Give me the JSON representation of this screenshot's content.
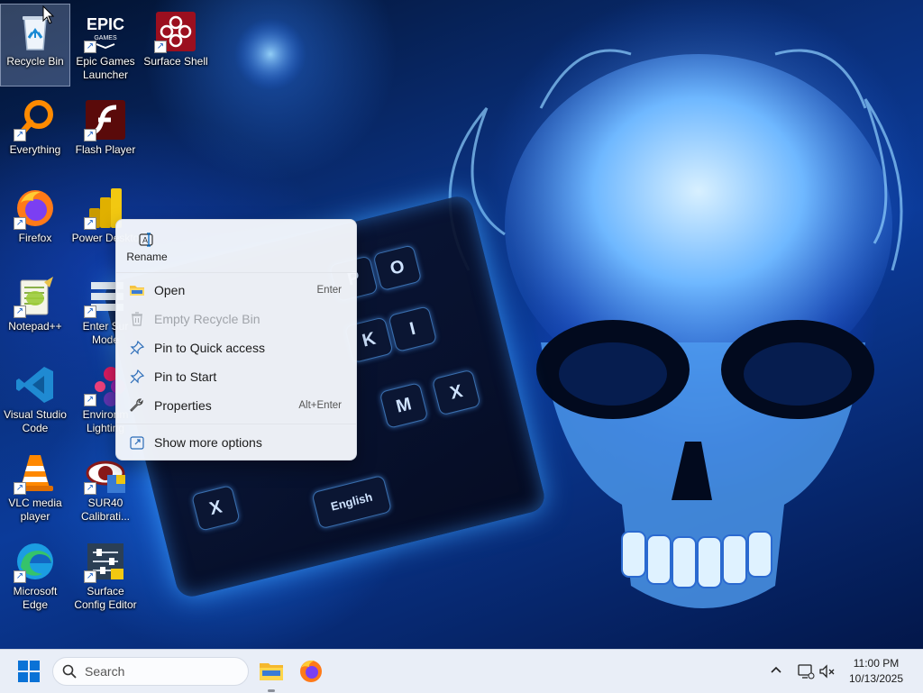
{
  "desktop": {
    "icons": [
      {
        "label": "Recycle Bin",
        "icon": "recycle-bin-icon"
      },
      {
        "label": "Epic Games Launcher",
        "icon": "epic-games-icon"
      },
      {
        "label": "Surface Shell",
        "icon": "surface-shell-icon"
      },
      {
        "label": "Everything",
        "icon": "everything-search-icon"
      },
      {
        "label": "Flash Player",
        "icon": "flash-player-icon"
      },
      {
        "label": "Firefox",
        "icon": "firefox-icon"
      },
      {
        "label": "Power Deskto",
        "icon": "power-bi-icon"
      },
      {
        "label": "Notepad++",
        "icon": "notepad-plus-plus-icon"
      },
      {
        "label": "Enter Sur Mode",
        "icon": "surface-mode-icon"
      },
      {
        "label": "Visual Studio Code",
        "icon": "vscode-icon"
      },
      {
        "label": "Environm Lighting",
        "icon": "environment-lighting-icon"
      },
      {
        "label": "VLC media player",
        "icon": "vlc-icon"
      },
      {
        "label": "SUR40 Calibrati...",
        "icon": "sur40-calibration-icon"
      },
      {
        "label": "Microsoft Edge",
        "icon": "edge-icon"
      },
      {
        "label": "Surface Config Editor",
        "icon": "surface-config-editor-icon"
      }
    ],
    "epic_logo_text": "EPIC",
    "epic_logo_sub": "GAMES",
    "wallpaper_keys": [
      "P",
      "O",
      "K",
      "I",
      "M",
      "X",
      "English"
    ]
  },
  "context_menu": {
    "rename_label": "Rename",
    "items": [
      {
        "label": "Open",
        "shortcut": "Enter",
        "icon": "folder-open-icon",
        "enabled": true
      },
      {
        "label": "Empty Recycle Bin",
        "shortcut": "",
        "icon": "trash-icon",
        "enabled": false
      },
      {
        "label": "Pin to Quick access",
        "shortcut": "",
        "icon": "pin-icon",
        "enabled": true
      },
      {
        "label": "Pin to Start",
        "shortcut": "",
        "icon": "pin-icon",
        "enabled": true
      },
      {
        "label": "Properties",
        "shortcut": "Alt+Enter",
        "icon": "wrench-icon",
        "enabled": true
      }
    ],
    "more_options": {
      "label": "Show more options",
      "icon": "share-icon"
    }
  },
  "taskbar": {
    "search_placeholder": "Search",
    "apps": [
      {
        "name": "File Explorer",
        "icon": "file-explorer-icon",
        "active": true
      },
      {
        "name": "Firefox",
        "icon": "firefox-icon",
        "active": false
      }
    ],
    "clock": {
      "time": "11:00 PM",
      "date": "10/13/2025"
    }
  },
  "colors": {
    "taskbar_bg": "#e9eef7",
    "menu_bg": "#f3f6fb",
    "accent": "#0067c0",
    "wallpaper_blue": "#0b3b9a"
  }
}
